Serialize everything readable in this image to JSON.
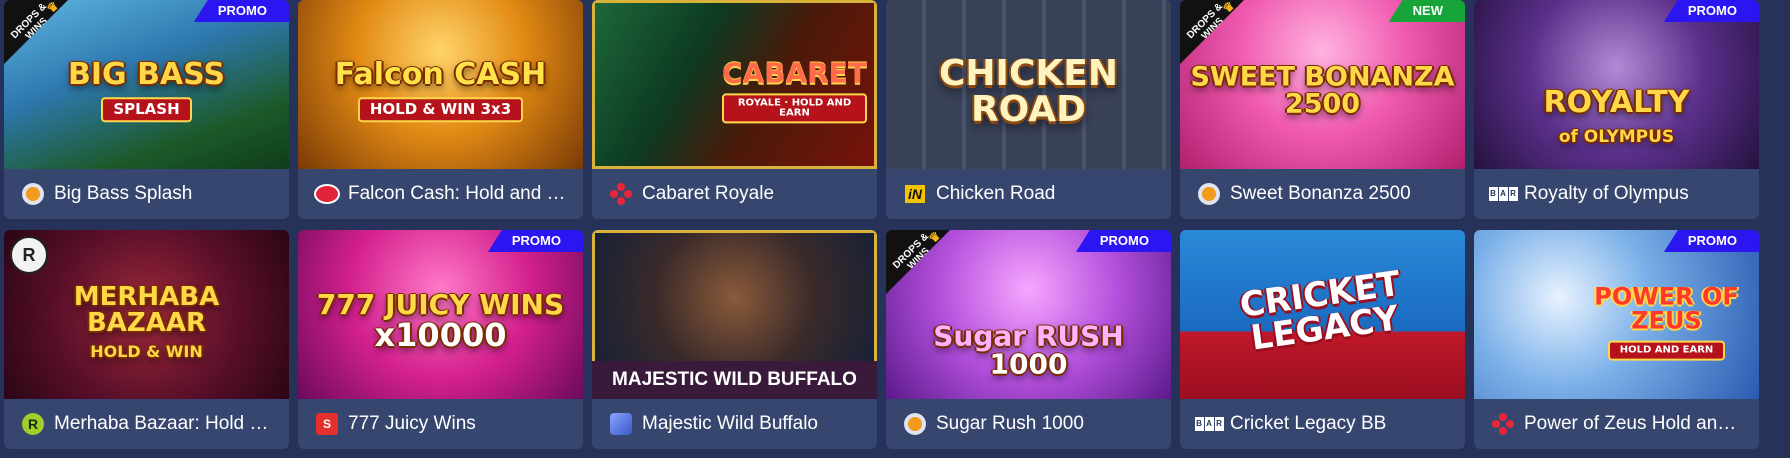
{
  "colors": {
    "page_bg": "#26325a",
    "card_bg": "#36466f",
    "promo_badge": "#2b16f2",
    "new_badge": "#17a53a"
  },
  "games": [
    {
      "name": "Big Bass Splash",
      "badge": "PROMO",
      "art_title": "BIG BASS",
      "art_sub": "SPLASH",
      "provider_icon": "pragmatic-play-icon",
      "drops_wins": true
    },
    {
      "name": "Falcon Cash: Hold and …",
      "badge": "",
      "art_title": "Falcon CASH",
      "art_sub": "HOLD & WIN 3x3",
      "provider_icon": "red-oval-provider-icon",
      "drops_wins": false
    },
    {
      "name": "Cabaret Royale",
      "badge": "",
      "art_title": "CABARET",
      "art_sub": "ROYALE · HOLD AND EARN",
      "provider_icon": "dots-provider-icon",
      "drops_wins": false
    },
    {
      "name": "Chicken Road",
      "badge": "",
      "art_title": "CHICKEN ROAD",
      "art_sub": "",
      "provider_icon": "inout-provider-icon",
      "drops_wins": false
    },
    {
      "name": "Sweet Bonanza 2500",
      "badge": "NEW",
      "art_title": "SWEET BONANZA 2500",
      "art_sub": "",
      "provider_icon": "pragmatic-play-icon",
      "drops_wins": true
    },
    {
      "name": "Royalty of Olympus",
      "badge": "PROMO",
      "art_title": "ROYALTY",
      "art_sub": "of OLYMPUS",
      "provider_icon": "bar-provider-icon",
      "drops_wins": false
    },
    {
      "name": "Merhaba Bazaar: Hold …",
      "badge": "",
      "art_title": "MERHABA BAZAAR",
      "art_sub": "HOLD & WIN",
      "provider_icon": "r-provider-icon",
      "drops_wins": false
    },
    {
      "name": "777 Juicy Wins",
      "badge": "PROMO",
      "art_title": "777 JUICY WINS",
      "art_sub": "x10000",
      "provider_icon": "square-provider-icon",
      "drops_wins": false
    },
    {
      "name": "Majestic Wild Buffalo",
      "badge": "",
      "art_title": "",
      "art_sub": "MAJESTIC WILD BUFFALO",
      "provider_icon": "layer-provider-icon",
      "drops_wins": false
    },
    {
      "name": "Sugar Rush 1000",
      "badge": "PROMO",
      "art_title": "Sugar RUSH",
      "art_sub": "1000",
      "provider_icon": "pragmatic-play-icon",
      "drops_wins": true
    },
    {
      "name": "Cricket Legacy BB",
      "badge": "",
      "art_title": "CRICKET LEGACY",
      "art_sub": "",
      "provider_icon": "bar-provider-icon",
      "drops_wins": false
    },
    {
      "name": "Power of Zeus Hold an…",
      "badge": "PROMO",
      "art_title": "POWER OF ZEUS",
      "art_sub": "HOLD AND EARN",
      "provider_icon": "dots-provider-icon",
      "drops_wins": false
    }
  ],
  "labels": {
    "drops_wins": "DROPS & WINS",
    "bar_logo": [
      "B",
      "A",
      "R"
    ]
  }
}
